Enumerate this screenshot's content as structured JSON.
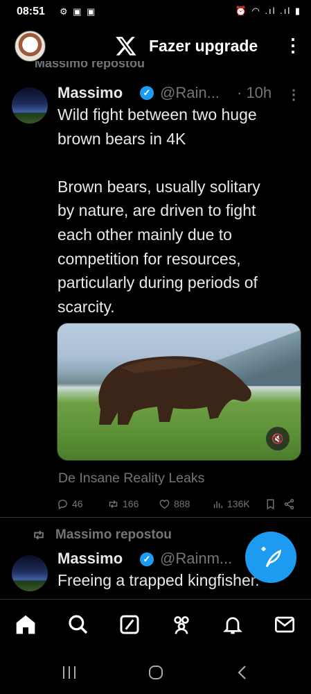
{
  "status_bar": {
    "time": "08:51",
    "left_icons": "⚙ ▣ ▣",
    "right_icons": "⏰ ◠ .ıl .ıl ▮"
  },
  "header": {
    "upgrade_label": "Fazer upgrade"
  },
  "partial_row_text": "Massimo repostou",
  "tweet1": {
    "name": "Massimo",
    "handle": "@Rain...",
    "time": "· 10h",
    "text": "Wild fight between two huge\nbrown bears in 4K\n\nBrown bears, usually solitary\nby nature, are driven to fight\neach other mainly due to\ncompetition for resources,\nparticularly during periods of\nscarcity.",
    "source": "De Insane Reality Leaks",
    "replies": "46",
    "reposts": "166",
    "likes": "888",
    "views": "136K"
  },
  "tweet2": {
    "repost_label": "Massimo repostou",
    "name": "Massimo",
    "handle": "@Rainm...",
    "text": "Freeing a trapped kingfisher."
  },
  "colors": {
    "accent": "#1d9bf0",
    "muted": "#71767b",
    "text": "#e7e9ea",
    "background": "#000000"
  }
}
